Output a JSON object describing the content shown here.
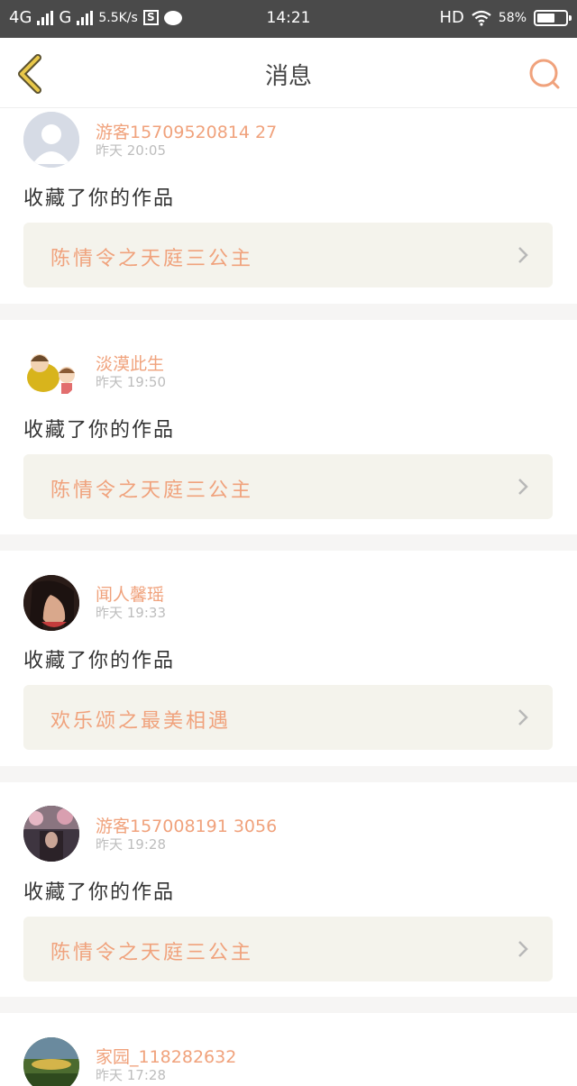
{
  "status_bar": {
    "network_left": "4G",
    "network_right": "G",
    "speed": "5.5K/s",
    "s_icon_label": "S",
    "time": "14:21",
    "hd": "HD",
    "battery": "58%"
  },
  "nav": {
    "title": "消息"
  },
  "messages": [
    {
      "username": "游客15709520814 27",
      "time": "昨天 20:05",
      "action": "收藏了你的作品",
      "work_title": "陈情令之天庭三公主"
    },
    {
      "username": "淡漠此生",
      "time": "昨天 19:50",
      "action": "收藏了你的作品",
      "work_title": "陈情令之天庭三公主"
    },
    {
      "username": "闻人馨瑶",
      "time": "昨天 19:33",
      "action": "收藏了你的作品",
      "work_title": "欢乐颂之最美相遇"
    },
    {
      "username": "游客157008191 3056",
      "time": "昨天 19:28",
      "action": "收藏了你的作品",
      "work_title": "陈情令之天庭三公主"
    },
    {
      "username": "家园_118282632",
      "time": "昨天 17:28",
      "action": "",
      "work_title": ""
    }
  ],
  "colors": {
    "accent_orange": "#f0a27c",
    "back_arrow_yellow": "#e9c84a",
    "card_bg": "#f4f3ec"
  }
}
